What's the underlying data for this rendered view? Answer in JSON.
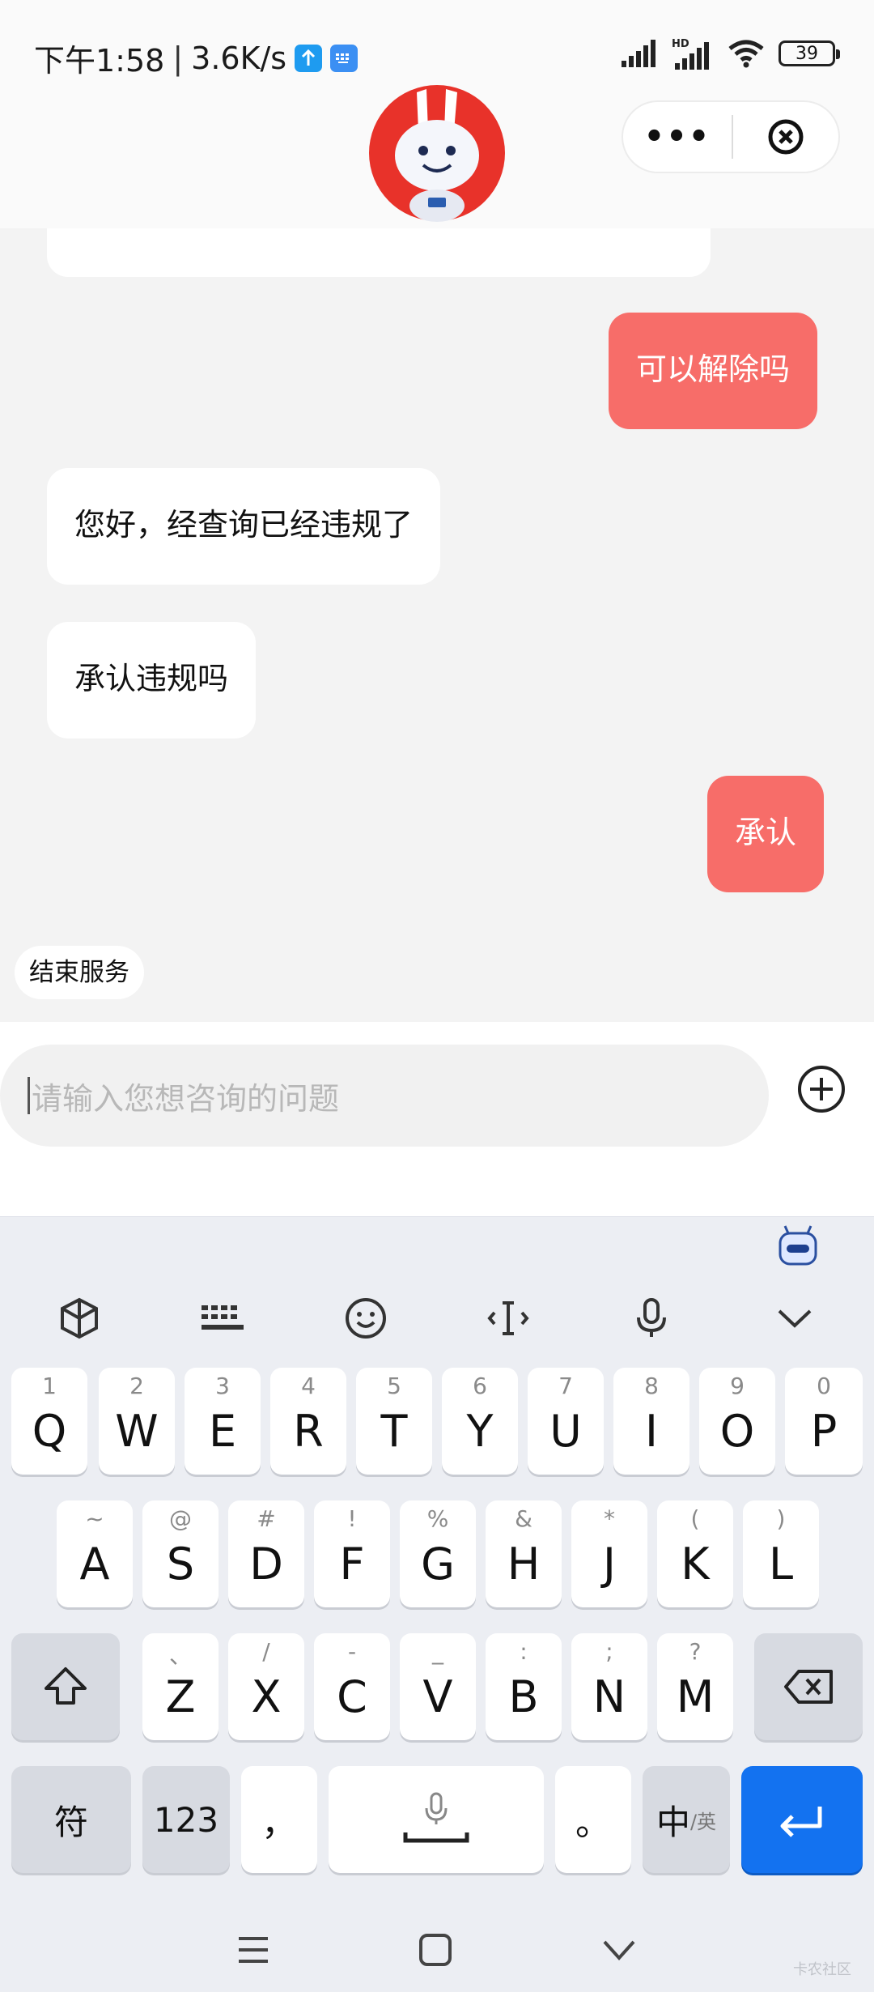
{
  "status_bar": {
    "time": "下午1:58",
    "network_speed": "3.6K/s",
    "battery": "39",
    "icons": [
      "upload-icon",
      "keyboard-notify-icon",
      "signal-icon",
      "hd-signal-icon",
      "wifi-icon",
      "battery-icon"
    ]
  },
  "header": {
    "more_label": "•••",
    "close_icon": "close-circle-icon",
    "mascot": "bunny-mascot-avatar"
  },
  "chat": {
    "messages": [
      {
        "side": "out",
        "text": "可以解除吗"
      },
      {
        "side": "in",
        "text": "您好，经查询已经违规了"
      },
      {
        "side": "in",
        "text": "承认违规吗"
      },
      {
        "side": "out",
        "text": "承认"
      }
    ],
    "end_service": "结束服务",
    "colors": {
      "outgoing": "#f76d69",
      "incoming": "#ffffff",
      "background": "#f3f3f3"
    }
  },
  "input": {
    "placeholder": "请输入您想咨询的问题",
    "plus_icon": "plus-circle-icon"
  },
  "keyboard": {
    "toolbar": [
      "cube-icon",
      "keyboard-icon",
      "emoji-icon",
      "text-cursor-icon",
      "mic-icon",
      "chevron-down-icon"
    ],
    "row1": [
      {
        "key": "Q",
        "hint": "1"
      },
      {
        "key": "W",
        "hint": "2"
      },
      {
        "key": "E",
        "hint": "3"
      },
      {
        "key": "R",
        "hint": "4"
      },
      {
        "key": "T",
        "hint": "5"
      },
      {
        "key": "Y",
        "hint": "6"
      },
      {
        "key": "U",
        "hint": "7"
      },
      {
        "key": "I",
        "hint": "8"
      },
      {
        "key": "O",
        "hint": "9"
      },
      {
        "key": "P",
        "hint": "0"
      }
    ],
    "row2": [
      {
        "key": "A",
        "hint": "~"
      },
      {
        "key": "S",
        "hint": "@"
      },
      {
        "key": "D",
        "hint": "#"
      },
      {
        "key": "F",
        "hint": "!"
      },
      {
        "key": "G",
        "hint": "%"
      },
      {
        "key": "H",
        "hint": "&"
      },
      {
        "key": "J",
        "hint": "*"
      },
      {
        "key": "K",
        "hint": "("
      },
      {
        "key": "L",
        "hint": ")"
      }
    ],
    "row3": [
      {
        "key": "Z",
        "hint": "、"
      },
      {
        "key": "X",
        "hint": "/"
      },
      {
        "key": "C",
        "hint": "-"
      },
      {
        "key": "V",
        "hint": "_"
      },
      {
        "key": "B",
        "hint": ":"
      },
      {
        "key": "N",
        "hint": ";"
      },
      {
        "key": "M",
        "hint": "?"
      }
    ],
    "symbols_label": "符",
    "numbers_label": "123",
    "comma_label": "，",
    "period_label": "。",
    "lang_main": "中",
    "lang_alt": "/英",
    "accent": "#1372f0"
  },
  "nav": [
    "menu-icon",
    "home-square-icon",
    "back-chevron-icon"
  ],
  "watermark": "卡农社区"
}
